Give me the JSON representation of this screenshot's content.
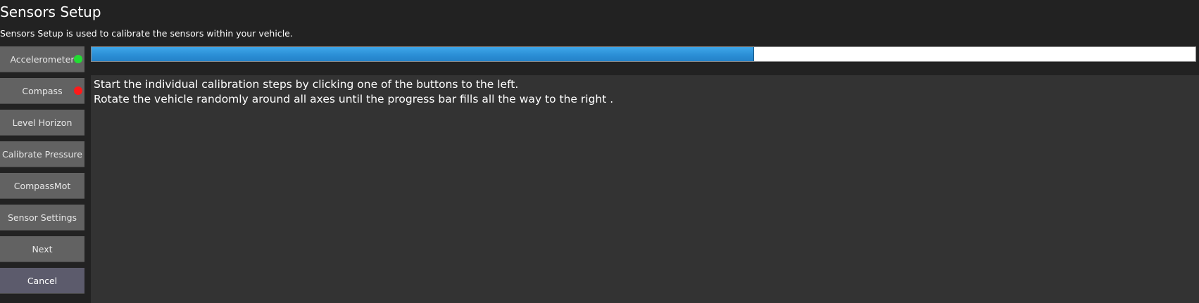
{
  "header": {
    "title": "Sensors Setup",
    "subtitle": "Sensors Setup is used to calibrate the sensors within your vehicle."
  },
  "sidebar": {
    "buttons": [
      {
        "label": "Accelerometer",
        "status": "green"
      },
      {
        "label": "Compass",
        "status": "red"
      },
      {
        "label": "Level Horizon"
      },
      {
        "label": "Calibrate Pressure"
      },
      {
        "label": "CompassMot"
      },
      {
        "label": "Sensor Settings"
      },
      {
        "label": "Next"
      },
      {
        "label": "Cancel"
      }
    ]
  },
  "progress": {
    "fraction": 0.6
  },
  "instructions": {
    "line1": "Start the individual calibration steps by clicking one of the buttons to the left.",
    "line2": "Rotate the vehicle randomly around all axes until the progress bar fills all the way to the right ."
  },
  "colors": {
    "background": "#222222",
    "button": "#626262",
    "cancel_button": "#5c5b6c",
    "panel": "#333333",
    "progress_fill": "#2b8fd6",
    "status_green": "#22dd33",
    "status_red": "#ff1a1a"
  }
}
